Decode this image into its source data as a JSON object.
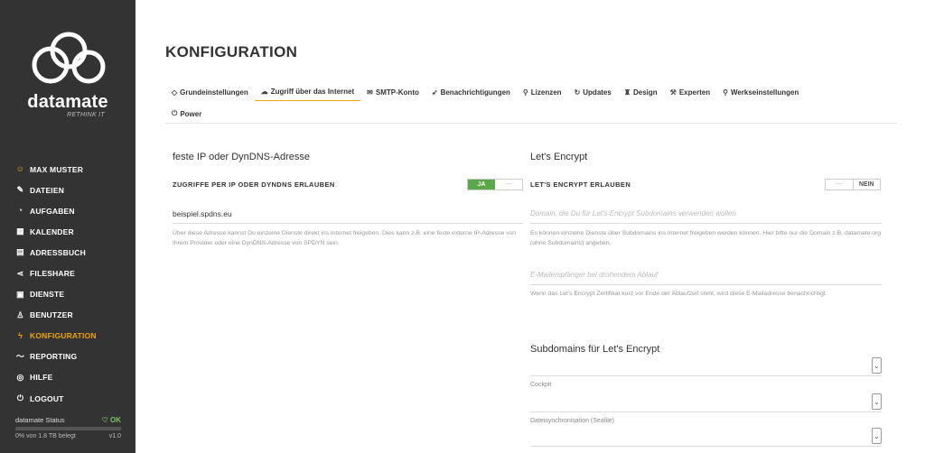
{
  "brand": {
    "name": "datamate",
    "tagline": "RETHINK IT"
  },
  "sidebar": {
    "items": [
      {
        "label": "MAX MUSTER",
        "icon": "user-icon",
        "glyph": "☺"
      },
      {
        "label": "DATEIEN",
        "icon": "edit-icon",
        "glyph": "✎"
      },
      {
        "label": "AUFGABEN",
        "icon": "clock-icon",
        "glyph": "◔"
      },
      {
        "label": "KALENDER",
        "icon": "calendar-icon",
        "glyph": "▦"
      },
      {
        "label": "ADRESSBUCH",
        "icon": "addressbook-icon",
        "glyph": "▤"
      },
      {
        "label": "FILESHARE",
        "icon": "share-icon",
        "glyph": "⋖"
      },
      {
        "label": "DIENSTE",
        "icon": "grid-icon",
        "glyph": "▣"
      },
      {
        "label": "BENUTZER",
        "icon": "users-icon",
        "glyph": "♙"
      },
      {
        "label": "KONFIGURATION",
        "icon": "bolt-icon",
        "glyph": "ϟ"
      },
      {
        "label": "REPORTING",
        "icon": "chart-line-icon",
        "glyph": "〜"
      },
      {
        "label": "HILFE",
        "icon": "help-icon",
        "glyph": "◎"
      },
      {
        "label": "LOGOUT",
        "icon": "power-icon",
        "glyph": "⏻"
      }
    ],
    "active_index": 8,
    "status": {
      "label": "datamate Status",
      "ok": "♡ OK",
      "usage": "0% von 1.8 TB belegt",
      "version": "v1.0",
      "usage_fraction": 0.0
    }
  },
  "page": {
    "title": "KONFIGURATION"
  },
  "tabs": [
    {
      "label": "Grundeinstellungen",
      "glyph": "◇",
      "icon": "tag-icon"
    },
    {
      "label": "Zugriff über das Internet",
      "glyph": "☁",
      "icon": "cloud-icon",
      "active": true
    },
    {
      "label": "SMTP-Konto",
      "glyph": "✉",
      "icon": "mail-icon"
    },
    {
      "label": "Benachrichtigungen",
      "glyph": "➶",
      "icon": "send-icon"
    },
    {
      "label": "Lizenzen",
      "glyph": "⚲",
      "icon": "key-icon"
    },
    {
      "label": "Updates",
      "glyph": "↻",
      "icon": "refresh-icon"
    },
    {
      "label": "Design",
      "glyph": "♜",
      "icon": "design-icon"
    },
    {
      "label": "Experten",
      "glyph": "⚒",
      "icon": "wrench-icon"
    },
    {
      "label": "Werkseinstellungen",
      "glyph": "⚲",
      "icon": "key-icon"
    },
    {
      "label": "Power",
      "glyph": "⏻",
      "icon": "power-icon"
    }
  ],
  "left": {
    "title": "feste IP oder DynDNS-Adresse",
    "toggle_label": "ZUGRIFFE PER IP ODER DYNDNS ERLAUBEN",
    "toggle_on": "JA",
    "address_value": "beispiel.spdns.eu",
    "help": "Über diese Adresse kannst Du einzelne Dienste direkt ins Internet freigeben. Dies kann z.B. eine feste externe IP-Adresse von Ihrem Provider oder eine DynDNS-Adresse von SPDYN sein."
  },
  "right": {
    "title": "Let's Encrypt",
    "toggle_label": "LET'S ENCRYPT ERLAUBEN",
    "toggle_off": "NEIN",
    "domain_placeholder": "Domain, die Du für Let's Encrypt Subdomains verwenden wollen",
    "domain_help": "Es können einzelne Dienste über Subdomains ins Internet freigeben werden können. Hier bitte nur die Domain z.B. datamate.org (ohne Subdomains) angeben.",
    "email_placeholder": "E-Mailempfänger bei drohendem Ablauf",
    "email_help": "Wenn das Let's Encrypt Zertifikat kurz vor Ende der Ablaufzeit steht, wird diese E-Mailadresse benachrichtigt.",
    "subdomains_title": "Subdomains für Let's Encrypt",
    "subdomains": [
      "Cockpit",
      "Dateisynchronisation (Seafile)"
    ]
  }
}
